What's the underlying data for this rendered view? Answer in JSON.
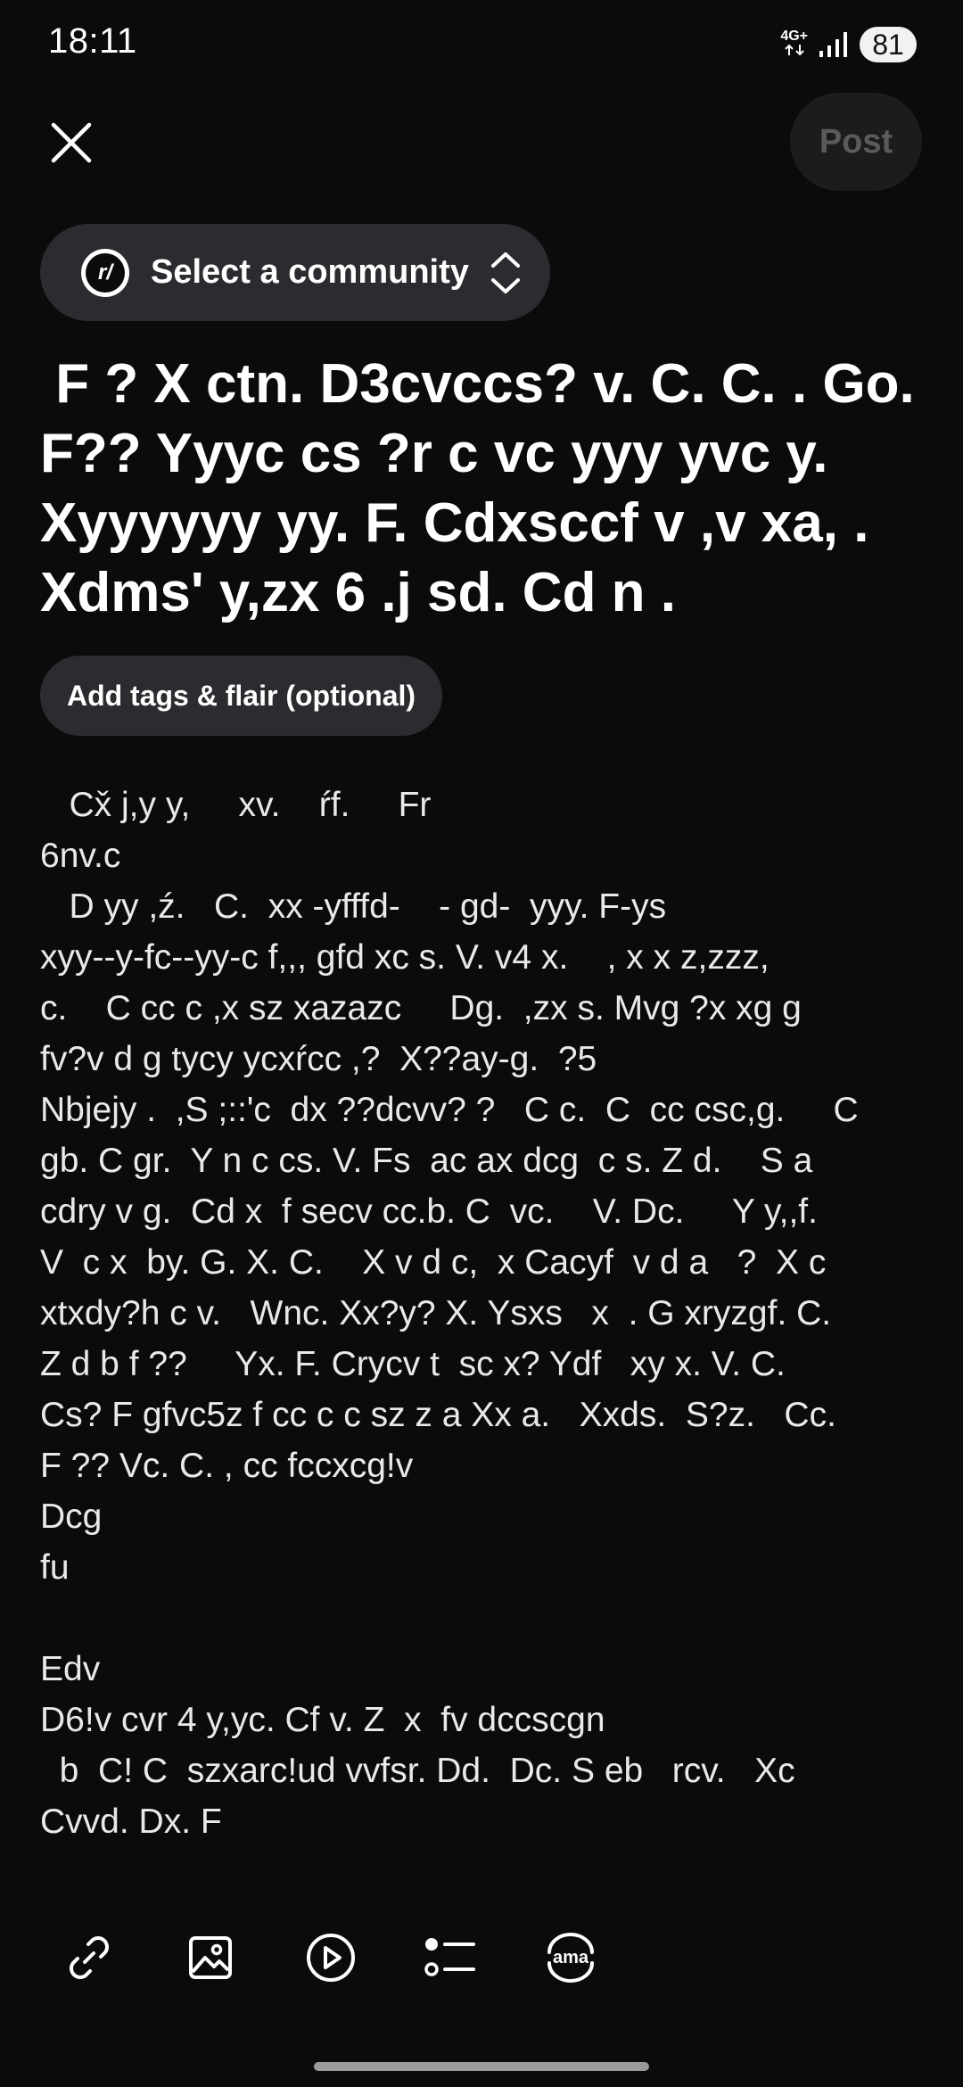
{
  "status_bar": {
    "time": "18:11",
    "network_type": "4G+",
    "battery": "81",
    "icons": [
      "data-arrows-icon",
      "signal-icon",
      "battery-icon"
    ]
  },
  "top_bar": {
    "close_icon": "close-icon",
    "post_label": "Post"
  },
  "community": {
    "logo_text": "r/",
    "label": "Select a community",
    "chevron_icon": "up-down-chevron-icon"
  },
  "title": " F ? X ctn. D3cvccs? v. C. C. . Go.\nF?? Yyyc cs ?r c vc yyy yvc y.\nXyyyyyy yy. F. Cdxsccf v ,v xa, .\nXdms' y,zx 6 .j sd. Cd n .",
  "tags_label": "Add tags & flair (optional)",
  "body_text": "   Cx̌ j,y y,     xv.    ŕf.     Fr\n6nv.c\n   D yy ,ź.   C.  xx -yfffd-    - gd-  yyy. F-ys\nxyy--y-fc--yy-c f,,, gfd xc s. V. v4 x.    , x x z,zzz,\nc.    C cc c ,x sz xazazc     Dg.  ,zx s. Mvg ?x xg g\nfv?v d g tycy ycxŕcc ,?  X??ay-g.  ?5\nNbjejy .  ,S ;::'c  dx ??dcvv? ?   C c.  C  cc csc,g.     C\ngb. C gr.  Y n c cs. V. Fs  ac ax dcg  c s. Z d.    S a\ncdry v g.  Cd x  f secv cc.b. C  vc.    V. Dc.     Y y,,f.\nV  c x  by. G. X. C.    X v d c,  x Cacyf  v d a   ?  X c\nxtxdy?h c v.   Wnc. Xx?y? X. Ysxs   x  . G xryzgf. C.\nZ d b f ??     Yx. F. Crycv t  sc x? Ydf   xy x. V. C.\nCs? F gfvc5z f cc c c sz z a Xx a.   Xxds.  S?z.   Cc.\nF ?? Vc. C. , cc fccxcg!v\nDcg\nfu\n\nEdv\nD6!v cvr 4 y,yc. Cf v. Z  x  fv dccscgn\n  b  C! C  szxarc!ud vvfsr. Dd.  Dc. S eb   rcv.   Xc\nCvvd. Dx. F",
  "toolbar": {
    "items": [
      {
        "icon": "link-icon"
      },
      {
        "icon": "image-icon"
      },
      {
        "icon": "video-icon"
      },
      {
        "icon": "poll-icon"
      },
      {
        "icon": "ama-icon",
        "label": "ama"
      }
    ]
  },
  "colors": {
    "background": "#0b0b0c",
    "pill": "#2a2c2f",
    "post_disabled_bg": "#1c1c1e",
    "post_disabled_text": "#5b5b5e",
    "text": "#ffffff"
  }
}
